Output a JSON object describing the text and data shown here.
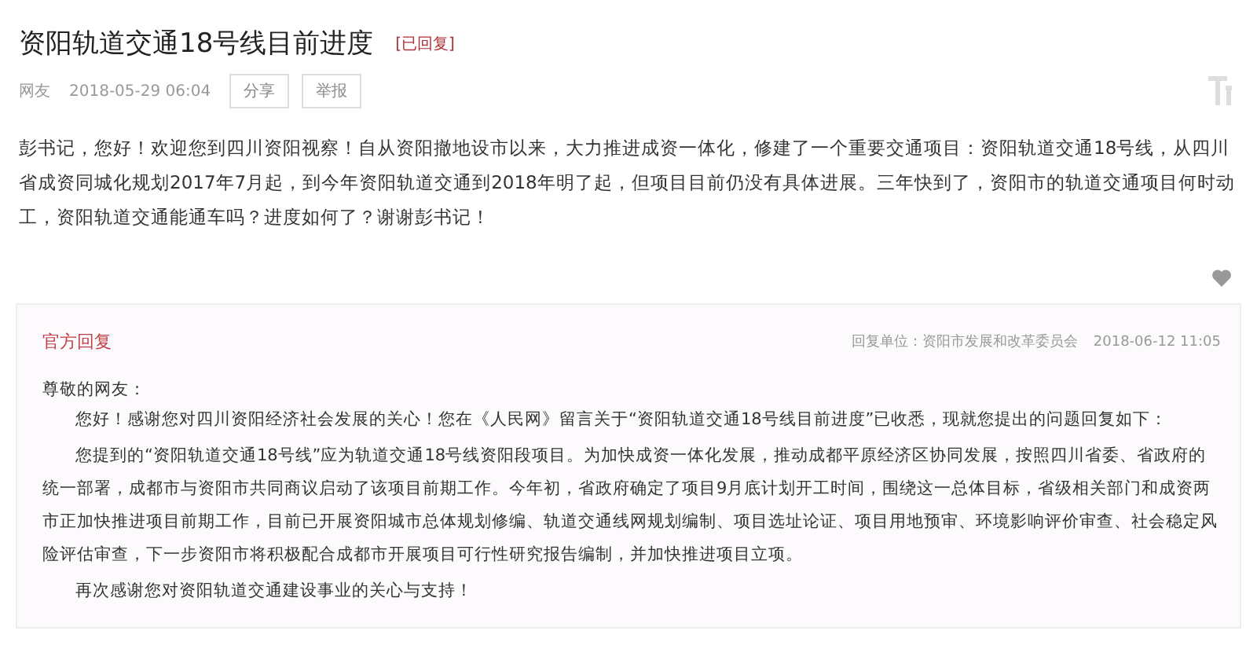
{
  "post": {
    "title": "资阳轨道交通18号线目前进度",
    "status": "[已回复]",
    "author": "网友",
    "time": "2018-05-29 06:04",
    "actions": [
      "分享",
      "举报"
    ],
    "body": "彭书记，您好！欢迎您到四川资阳视察！自从资阳撤地设市以来，大力推进成资一体化，修建了一个重要交通项目：资阳轨道交通18号线，从四川省成资同城化规划2017年7月起，到今年资阳轨道交通到2018年明了起，但项目目前仍没有具体进展。三年快到了，资阳市的轨道交通项目何时动工，资阳轨道交通能通车吗？进度如何了？谢谢彭书记！"
  },
  "reply": {
    "label": "官方回复",
    "unit": "回复单位：资阳市发展和改革委员会",
    "time": "2018-06-12 11:05",
    "greeting": "尊敬的网友：",
    "paragraphs": [
      "您好！感谢您对四川资阳经济社会发展的关心！您在《人民网》留言关于“资阳轨道交通18号线目前进度”已收悉，现就您提出的问题回复如下：",
      "您提到的“资阳轨道交通18号线”应为轨道交通18号线资阳段项目。为加快成资一体化发展，推动成都平原经济区协同发展，按照四川省委、省政府的统一部署，成都市与资阳市共同商议启动了该项目前期工作。今年初，省政府确定了项目9月底计划开工时间，围绕这一总体目标，省级相关部门和成资两市正加快推进项目前期工作，目前已开展资阳城市总体规划修编、轨道交通线网规划编制、项目选址论证、项目用地预审、环境影响评价审查、社会稳定风险评估审查，下一步资阳市将积极配合成都市开展项目可行性研究报告编制，并加快推进项目立项。",
      "再次感谢您对资阳轨道交通建设事业的关心与支持！"
    ]
  }
}
